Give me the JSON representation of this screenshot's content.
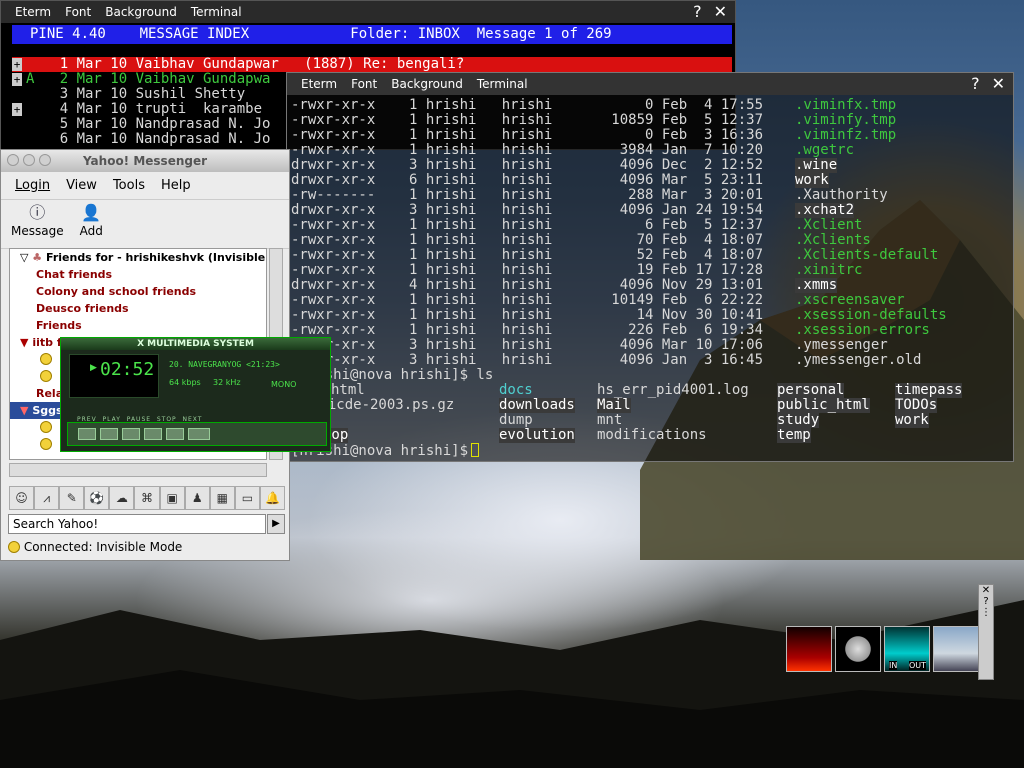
{
  "eterm_menu": [
    "Eterm",
    "Font",
    "Background",
    "Terminal"
  ],
  "eterm_controls": [
    "?",
    "✕"
  ],
  "pine": {
    "header": "PINE 4.40    MESSAGE INDEX            Folder: INBOX  Message 1 of 269",
    "rows": [
      {
        "flag": "+",
        "text": "    1 Mar 10 Vaibhav Gundapwar   (1887) Re: bengali?"
      },
      {
        "flag": "+",
        "text": "A   2 Mar 10 Vaibhav Gundapwa"
      },
      {
        "flag": "",
        "text": "    3 Mar 10 Sushil Shetty"
      },
      {
        "flag": "+",
        "text": "    4 Mar 10 trupti  karambe"
      },
      {
        "flag": "",
        "text": "    5 Mar 10 Nandprasad N. Jo"
      },
      {
        "flag": "",
        "text": "    6 Mar 10 Nandprasad N. Jo"
      }
    ]
  },
  "terminal": {
    "listing": [
      {
        "perm": "-rwxr-xr-x    1 hrishi   hrishi           0 Feb  4 17:55",
        "name": ".viminfx.tmp",
        "style": "green"
      },
      {
        "perm": "-rwxr-xr-x    1 hrishi   hrishi       10859 Feb  5 12:37",
        "name": ".viminfy.tmp",
        "style": "green"
      },
      {
        "perm": "-rwxr-xr-x    1 hrishi   hrishi           0 Feb  3 16:36",
        "name": ".viminfz.tmp",
        "style": "green"
      },
      {
        "perm": "-rwxr-xr-x    1 hrishi   hrishi        3984 Jan  7 10:20",
        "name": ".wgetrc",
        "style": "green"
      },
      {
        "perm": "drwxr-xr-x    3 hrishi   hrishi        4096 Dec  2 12:52",
        "name": ".wine",
        "style": "hi"
      },
      {
        "perm": "drwxr-xr-x    6 hrishi   hrishi        4096 Mar  5 23:11",
        "name": "work",
        "style": "hi"
      },
      {
        "perm": "-rw-------    1 hrishi   hrishi         288 Mar  3 20:01",
        "name": ".Xauthority",
        "style": ""
      },
      {
        "perm": "drwxr-xr-x    3 hrishi   hrishi        4096 Jan 24 19:54",
        "name": ".xchat2",
        "style": "hi"
      },
      {
        "perm": "-rwxr-xr-x    1 hrishi   hrishi           6 Feb  5 12:37",
        "name": ".Xclient",
        "style": "green"
      },
      {
        "perm": "-rwxr-xr-x    1 hrishi   hrishi          70 Feb  4 18:07",
        "name": ".Xclients",
        "style": "green"
      },
      {
        "perm": "-rwxr-xr-x    1 hrishi   hrishi          52 Feb  4 18:07",
        "name": ".Xclients-default",
        "style": "green"
      },
      {
        "perm": "-rwxr-xr-x    1 hrishi   hrishi          19 Feb 17 17:28",
        "name": ".xinitrc",
        "style": "green"
      },
      {
        "perm": "drwxr-xr-x    4 hrishi   hrishi        4096 Nov 29 13:01",
        "name": ".xmms",
        "style": "hi"
      },
      {
        "perm": "-rwxr-xr-x    1 hrishi   hrishi       10149 Feb  6 22:22",
        "name": ".xscreensaver",
        "style": "green"
      },
      {
        "perm": "-rwxr-xr-x    1 hrishi   hrishi          14 Nov 30 10:41",
        "name": ".xsession-defaults",
        "style": "green"
      },
      {
        "perm": "-rwxr-xr-x    1 hrishi   hrishi         226 Feb  6 19:34",
        "name": ".xsession-errors",
        "style": "green"
      },
      {
        "perm": "drwxr-xr-x    3 hrishi   hrishi        4096 Mar 10 17:06",
        "name": ".ymessenger",
        "style": ""
      },
      {
        "perm": "drwxr-xr-x    3 hrishi   hrishi        4096 Jan  3 16:45",
        "name": ".ymessenger.old",
        "style": ""
      }
    ],
    "ls_prompt": "[hrishi@nova hrishi]$ ls",
    "ls_cols": [
      [
        {
          "t": "html",
          "s": ""
        },
        {
          "t": "s-icde-2003.ps.gz",
          "s": ""
        },
        {
          "t": "",
          "s": ""
        },
        {
          "t": "top",
          "s": "hi"
        }
      ],
      [
        {
          "t": "docs",
          "s": "cyan"
        },
        {
          "t": "downloads",
          "s": "hi"
        },
        {
          "t": "dump",
          "s": ""
        },
        {
          "t": "evolution",
          "s": "hi"
        }
      ],
      [
        {
          "t": "hs_err_pid4001.log",
          "s": ""
        },
        {
          "t": "Mail",
          "s": "hi"
        },
        {
          "t": "mnt",
          "s": ""
        },
        {
          "t": "modifications",
          "s": ""
        }
      ],
      [
        {
          "t": "personal",
          "s": "hi"
        },
        {
          "t": "public_html",
          "s": "hi"
        },
        {
          "t": "study",
          "s": "hi"
        },
        {
          "t": "temp",
          "s": "hi"
        }
      ],
      [
        {
          "t": "timepass",
          "s": "hi"
        },
        {
          "t": "TODOs",
          "s": "hi"
        },
        {
          "t": "work",
          "s": "hi"
        },
        {
          "t": "",
          "s": ""
        }
      ]
    ],
    "final_prompt": "[hrishi@nova hrishi]$"
  },
  "yahoo": {
    "title": "Yahoo! Messenger",
    "menu": [
      "Login",
      "View",
      "Tools",
      "Help"
    ],
    "toolbar": [
      {
        "label": "Message",
        "icon": "message-icon"
      },
      {
        "label": "Add",
        "icon": "add-user-icon"
      }
    ],
    "tree_header": "Friends for - hrishikeshvk (Invisible Mode)",
    "groups": [
      "Chat friends",
      "Colony and school friends",
      "Deusco friends",
      "Friends"
    ],
    "partial": [
      "iitb f",
      "Relat",
      "Sggs"
    ],
    "search_placeholder": "Search Yahoo!",
    "status": "Connected: Invisible Mode"
  },
  "xmms": {
    "title": "X MULTIMEDIA SYSTEM",
    "time": "02:52",
    "song": "20. NAVEGRANYOG <21:23>",
    "kbps_val": "64",
    "kbps_unit": "kbps",
    "khz_val": "32",
    "khz_unit": "kHz",
    "channel": "MONO",
    "labels": "PREV  PLAY  PAUSE  STOP  NEXT"
  },
  "applet_labels": [
    "IN",
    "OUT"
  ]
}
